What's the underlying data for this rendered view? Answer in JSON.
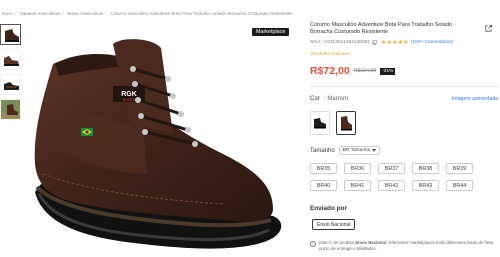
{
  "breadcrumb": [
    "Início",
    "Sapatos masculinos",
    "Botas masculinas",
    "Coturno Masculino Adventure Bota Para Trabalho Solado Borracha Costurado Resistente"
  ],
  "gallery": {
    "thumbnail_count": 4,
    "badge": "Marketplace",
    "logo_text": "RGK",
    "logo_sub": "BOOTS"
  },
  "product": {
    "title": "Coturno Masculino Adventure Bota Para Trabalho Solado Borracha Costurado Resistente",
    "sku_label": "SKU:",
    "sku": "cr2312021462140292",
    "stars": "★★★★★",
    "reviews": "(100+ Comentários)",
    "vendor": "Vendedor indicado",
    "price": "R$72,00",
    "old_price": "R$104,90",
    "discount": "-31%"
  },
  "color": {
    "label": "Cor",
    "value": "Marrom",
    "zoom_link": "Imagem aumentada",
    "options": [
      "black",
      "brown"
    ],
    "selected": 1
  },
  "size": {
    "label": "Tamanho",
    "selector": "BR Tamanho",
    "options": [
      "BR35",
      "BR36",
      "BR37",
      "BR38",
      "BR39",
      "BR40",
      "BR41",
      "BR42",
      "BR43",
      "BR44"
    ]
  },
  "shipping": {
    "label": "Enviado por",
    "option": "Envio Nacional",
    "note_prefix": "Este é um produto ",
    "note_bold": "Envio Nacional",
    "note_rest": ". Diferentes marketplaces terão diferentes taxas de frete, prazo de entrega e atividades."
  },
  "colors": {
    "price": "#e2523c",
    "stars": "#f5a623",
    "vendor": "#e8a33c",
    "link": "#2c7be5"
  }
}
